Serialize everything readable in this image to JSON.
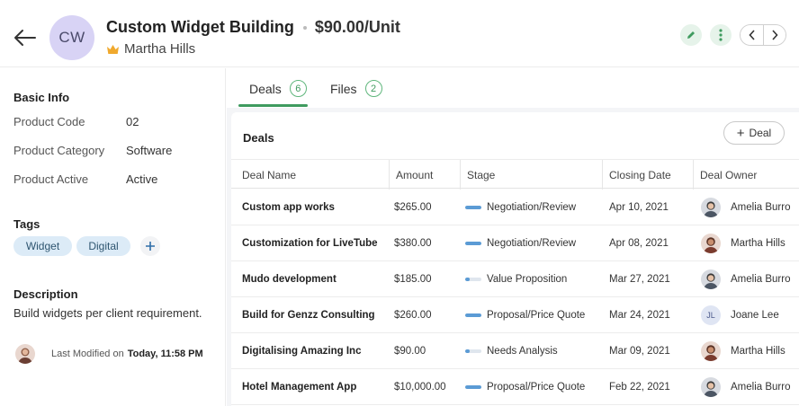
{
  "header": {
    "initials": "CW",
    "title": "Custom Widget Building",
    "price": "$90.00/Unit",
    "owner": "Martha Hills"
  },
  "left": {
    "basic_info_heading": "Basic Info",
    "fields": [
      {
        "label": "Product Code",
        "value": "02"
      },
      {
        "label": "Product Category",
        "value": "Software"
      },
      {
        "label": "Product Active",
        "value": "Active"
      }
    ],
    "tags_heading": "Tags",
    "tags": [
      "Widget",
      "Digital"
    ],
    "description_heading": "Description",
    "description": "Build widgets per client requirement.",
    "last_modified_label": "Last Modified on",
    "last_modified_value": "Today, 11:58 PM"
  },
  "tabs": [
    {
      "label": "Deals",
      "count": "6"
    },
    {
      "label": "Files",
      "count": "2"
    }
  ],
  "deals": {
    "title": "Deals",
    "add_label": "Deal",
    "columns": [
      "Deal Name",
      "Amount",
      "Stage",
      "Closing Date",
      "Deal Owner"
    ],
    "rows": [
      {
        "name": "Custom app works",
        "amount": "$265.00",
        "stage": "Negotiation/Review",
        "stage_progress": 1.0,
        "date": "Apr 10, 2021",
        "owner": "Amelia Burro",
        "owner_initials": ""
      },
      {
        "name": "Customization for LiveTube",
        "amount": "$380.00",
        "stage": "Negotiation/Review",
        "stage_progress": 1.0,
        "date": "Apr 08, 2021",
        "owner": "Martha Hills",
        "owner_initials": ""
      },
      {
        "name": "Mudo development",
        "amount": "$185.00",
        "stage": "Value Proposition",
        "stage_progress": 0.25,
        "date": "Mar 27, 2021",
        "owner": "Amelia Burro",
        "owner_initials": ""
      },
      {
        "name": "Build for Genzz Consulting",
        "amount": "$260.00",
        "stage": "Proposal/Price Quote",
        "stage_progress": 1.0,
        "date": "Mar 24, 2021",
        "owner": "Joane Lee",
        "owner_initials": "JL"
      },
      {
        "name": "Digitalising Amazing Inc",
        "amount": "$90.00",
        "stage": "Needs Analysis",
        "stage_progress": 0.25,
        "date": "Mar 09, 2021",
        "owner": "Martha Hills",
        "owner_initials": ""
      },
      {
        "name": "Hotel Management App",
        "amount": "$10,000.00",
        "stage": "Proposal/Price Quote",
        "stage_progress": 1.0,
        "date": "Feb 22, 2021",
        "owner": "Amelia Burro",
        "owner_initials": ""
      }
    ]
  },
  "colors": {
    "accent_green": "#3f9b5f",
    "stage_blue": "#5b9bd5",
    "tag_bg": "#dcebf7",
    "avatar_bg": "#d8d3f5"
  }
}
